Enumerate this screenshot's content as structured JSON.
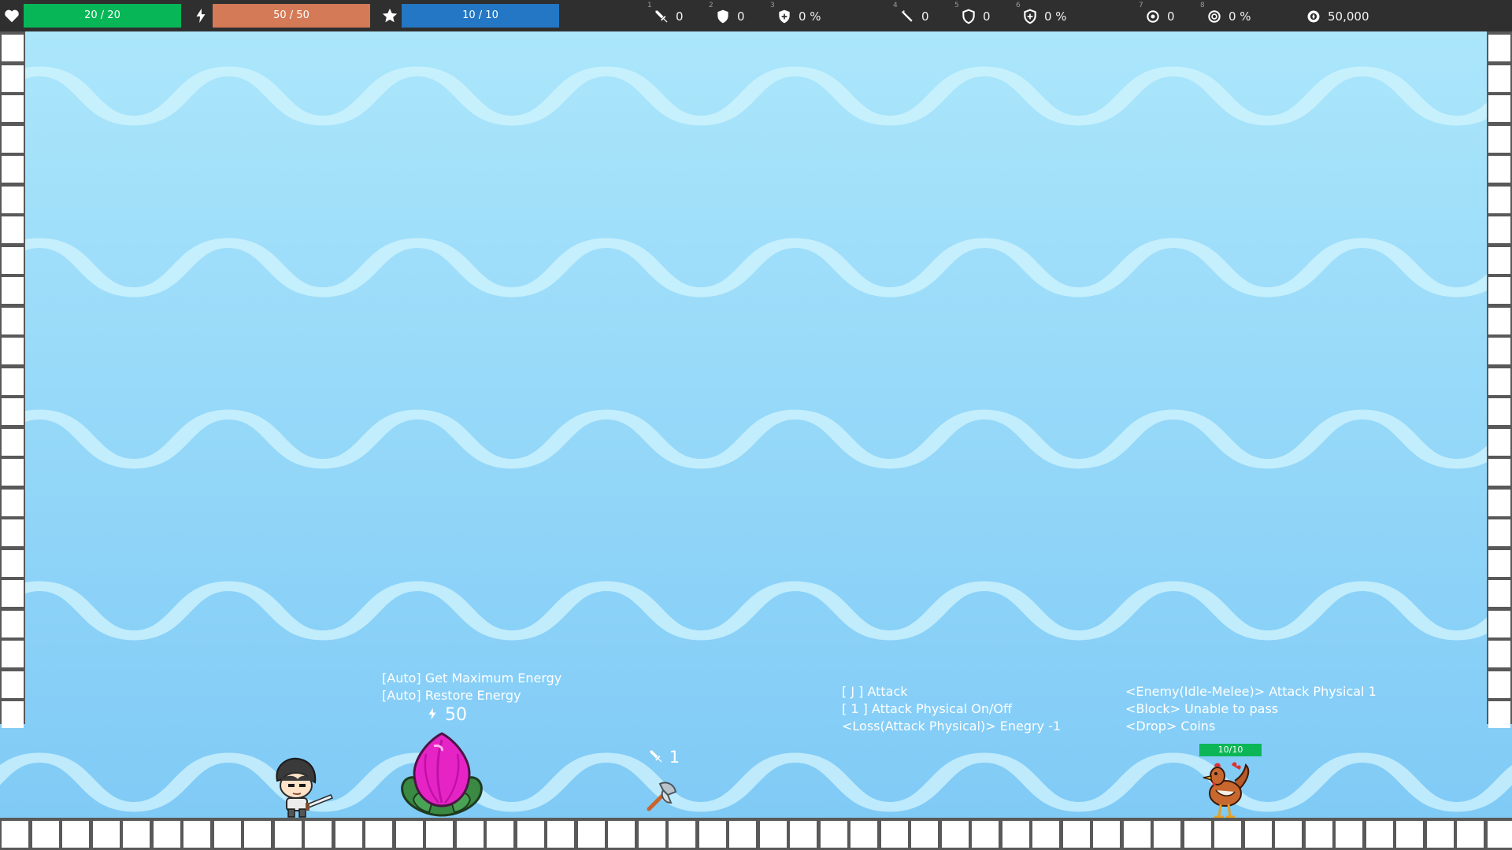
{
  "hud": {
    "health": {
      "icon": "heart-icon",
      "text": "20 / 20",
      "current": 20,
      "max": 20,
      "color": "#06b657"
    },
    "energy": {
      "icon": "lightning-icon",
      "text": "50 / 50",
      "current": 50,
      "max": 50,
      "color": "#d47a56"
    },
    "experience": {
      "icon": "star-icon",
      "text": "10 / 10",
      "current": 10,
      "max": 10,
      "color": "#2377c4"
    },
    "stats": [
      {
        "slot": "1",
        "icon": "sword-icon",
        "value": "0"
      },
      {
        "slot": "2",
        "icon": "shield-icon",
        "value": "0"
      },
      {
        "slot": "3",
        "icon": "shield-plus-icon",
        "value": "0 %"
      },
      {
        "slot": "4",
        "icon": "wand-icon",
        "value": "0"
      },
      {
        "slot": "5",
        "icon": "magic-shield-icon",
        "value": "0"
      },
      {
        "slot": "6",
        "icon": "magic-shield-plus-icon",
        "value": "0 %"
      },
      {
        "slot": "7",
        "icon": "ring-icon",
        "value": "0"
      },
      {
        "slot": "8",
        "icon": "ring-plus-icon",
        "value": "0 %"
      }
    ],
    "coins": {
      "icon": "coin-icon",
      "value": "50,000"
    }
  },
  "flower": {
    "lines": [
      "[Auto] Get Maximum Energy",
      "[Auto] Restore Energy"
    ],
    "energy_icon": "lightning-icon",
    "energy_value": "50",
    "color": "#e624c6"
  },
  "weapon": {
    "attack_icon": "sword-icon",
    "attack_value": "1",
    "item_icon": "axe-icon"
  },
  "attack_info": {
    "lines": [
      "[ J ] Attack",
      "[ 1 ] Attack Physical  On/Off",
      "<Loss(Attack Physical)> Enegry -1"
    ]
  },
  "enemy": {
    "lines": [
      "<Enemy(Idle-Melee)> Attack Physical 1",
      "<Block> Unable to pass",
      "<Drop> Coins"
    ],
    "hp_text": "10/10",
    "hp_current": 10,
    "hp_max": 10,
    "sprite": "rooster-enemy"
  },
  "player": {
    "sprite": "knight-player"
  }
}
